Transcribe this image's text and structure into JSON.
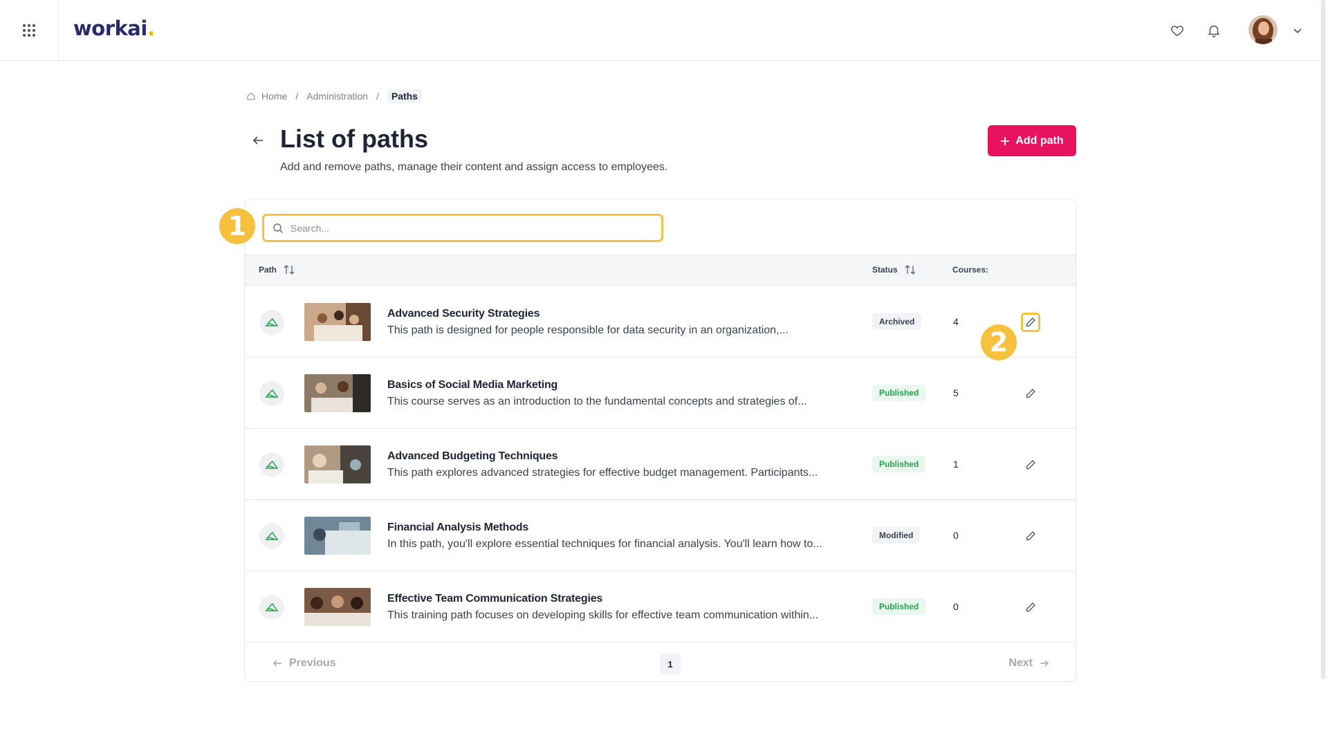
{
  "header": {
    "logo_text": "workai",
    "logo_dot": ".",
    "icons": [
      "apps-grid-icon",
      "heart-icon",
      "bell-icon",
      "chevron-down-icon"
    ]
  },
  "breadcrumb": {
    "home": "Home",
    "separator": "/",
    "administration": "Administration",
    "current": "Paths"
  },
  "page": {
    "title": "List of paths",
    "subtitle": "Add and remove paths, manage their content and assign access to employees.",
    "add_button": "Add path"
  },
  "search": {
    "placeholder": "Search..."
  },
  "table": {
    "columns": {
      "path": "Path",
      "status": "Status",
      "courses": "Courses:"
    },
    "rows": [
      {
        "title": "Advanced Security Strategies",
        "description": "This path is designed for people responsible for data security in an organization,...",
        "status": "Archived",
        "courses": "4"
      },
      {
        "title": "Basics of Social Media Marketing",
        "description": "This course serves as an introduction to the fundamental concepts and strategies of...",
        "status": "Published",
        "courses": "5"
      },
      {
        "title": "Advanced Budgeting Techniques",
        "description": "This path explores advanced strategies for effective budget management. Participants...",
        "status": "Published",
        "courses": "1"
      },
      {
        "title": "Financial Analysis Methods",
        "description": "In this path, you'll explore essential techniques for financial analysis. You'll learn how to...",
        "status": "Modified",
        "courses": "0"
      },
      {
        "title": "Effective Team Communication Strategies",
        "description": "This training path focuses on developing skills for effective team communication within...",
        "status": "Published",
        "courses": "0"
      }
    ]
  },
  "pagination": {
    "previous": "Previous",
    "page": "1",
    "next": "Next"
  },
  "markers": {
    "one": "1",
    "two": "2"
  },
  "colors": {
    "accent": "#e8135f",
    "highlight": "#f6c23e",
    "published": "#22a24a",
    "brand": "#2b2a6b"
  }
}
